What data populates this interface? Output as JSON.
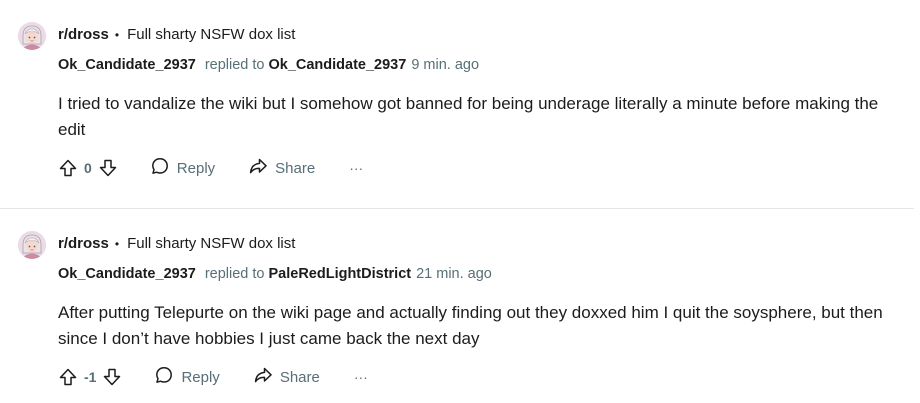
{
  "comments": [
    {
      "subreddit": "r/dross",
      "separator": "•",
      "post_title": "Full sharty NSFW dox list",
      "author": "Ok_Candidate_2937",
      "replied_to_label": "replied to",
      "replied_to": "Ok_Candidate_2937",
      "time": "9 min. ago",
      "body": "I tried to vandalize the wiki but I somehow got banned for being underage literally a minute before making the edit",
      "score": "0",
      "reply_label": "Reply",
      "share_label": "Share",
      "more_label": "···"
    },
    {
      "subreddit": "r/dross",
      "separator": "•",
      "post_title": "Full sharty NSFW dox list",
      "author": "Ok_Candidate_2937",
      "replied_to_label": "replied to",
      "replied_to": "PaleRedLightDistrict",
      "time": "21 min. ago",
      "body": "After putting Telepurte on the wiki page and actually finding out they doxxed him I quit the soysphere, but then since I don’t have hobbies I just came back the next day",
      "score": "-1",
      "reply_label": "Reply",
      "share_label": "Share",
      "more_label": "···"
    }
  ],
  "icons": {
    "upvote": "upvote-arrow-icon",
    "downvote": "downvote-arrow-icon",
    "reply": "speech-bubble-icon",
    "share": "share-arrow-icon",
    "avatar": "subreddit-avatar-icon"
  },
  "colors": {
    "text": "#1c1c1c",
    "muted": "#576f76",
    "divider": "#e5e5e5"
  }
}
